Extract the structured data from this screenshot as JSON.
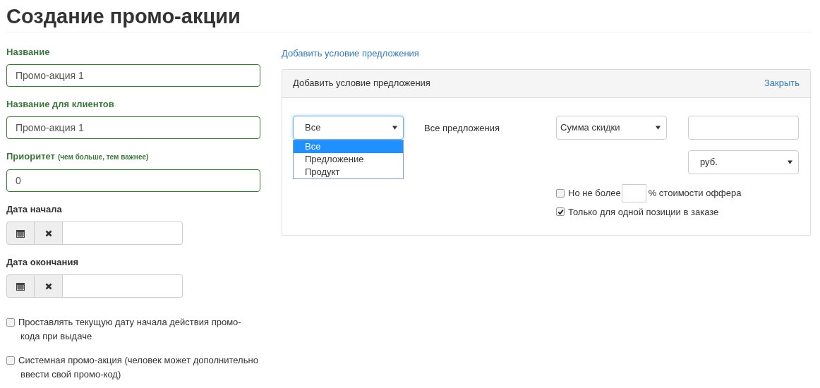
{
  "title": "Создание промо-акции",
  "fields": [
    {
      "kind": "text",
      "label": "Название",
      "valid": true,
      "value": "Промо-акция 1"
    },
    {
      "kind": "text",
      "label": "Название для клиентов",
      "valid": true,
      "value": "Промо-акция 1"
    },
    {
      "kind": "text",
      "label": "Приоритет",
      "hint": "(чем больше, тем важнее)",
      "valid": true,
      "value": "0"
    },
    {
      "kind": "date",
      "label": "Дата начала",
      "valid": false
    },
    {
      "kind": "date",
      "label": "Дата окончания",
      "valid": false
    }
  ],
  "checkboxes": [
    {
      "label": "Проставлять текущую дату начала действия промо-кода при выдаче",
      "checked": false
    },
    {
      "label": "Системная промо-акция (человек может дополнительно ввести свой промо-код)",
      "checked": false
    }
  ],
  "add_condition_link": "Добавить условие предложения",
  "panel": {
    "title": "Добавить условие предложения",
    "close": "Закрыть",
    "scope_select": {
      "value": "Все",
      "expanded": true,
      "options": [
        {
          "label": "Все",
          "selected": true
        },
        {
          "label": "Предложение",
          "selected": false
        },
        {
          "label": "Продукт",
          "selected": false
        }
      ]
    },
    "scope_text": "Все предложения",
    "discount_select": {
      "value": "Сумма скидки"
    },
    "currency_select": {
      "value": "руб."
    },
    "options": [
      {
        "kind": "limit",
        "label": "Но не более",
        "suffix": "% стоимости оффера",
        "checked": false
      },
      {
        "kind": "plain",
        "label": "Только для одной позиции в заказе",
        "checked": true
      }
    ]
  }
}
